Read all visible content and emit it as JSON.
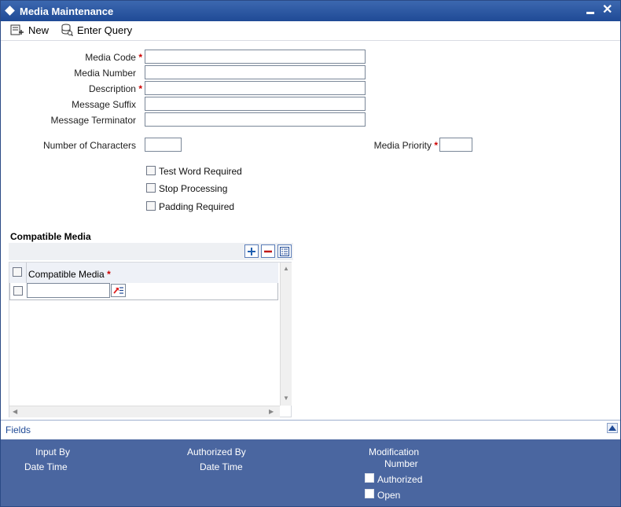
{
  "window": {
    "title": "Media Maintenance"
  },
  "toolbar": {
    "new_label": "New",
    "enter_query_label": "Enter Query"
  },
  "form": {
    "media_code_label": "Media Code",
    "media_number_label": "Media Number",
    "description_label": "Description",
    "message_suffix_label": "Message Suffix",
    "message_terminator_label": "Message Terminator",
    "number_of_characters_label": "Number of Characters",
    "media_priority_label": "Media Priority",
    "required_mark": "*",
    "media_code_value": "",
    "media_number_value": "",
    "description_value": "",
    "message_suffix_value": "",
    "message_terminator_value": "",
    "number_of_characters_value": "",
    "media_priority_value": ""
  },
  "options": {
    "test_word_required": "Test Word Required",
    "stop_processing": "Stop Processing",
    "padding_required": "Padding Required"
  },
  "compatible_media": {
    "section_title": "Compatible Media",
    "column_header": "Compatible Media",
    "rows": [
      {
        "value": ""
      }
    ]
  },
  "fields_bar": {
    "label": "Fields"
  },
  "footer": {
    "input_by": "Input By",
    "date_time_1": "Date Time",
    "authorized_by": "Authorized By",
    "date_time_2": "Date Time",
    "modification": "Modification",
    "number": "Number",
    "authorized": "Authorized",
    "open": "Open"
  }
}
